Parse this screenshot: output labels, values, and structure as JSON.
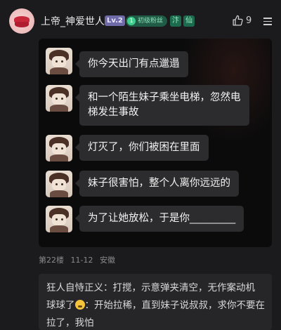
{
  "header": {
    "username": "上帝_神爱世人",
    "level": "Lv.2",
    "fan_badge_num": "1",
    "fan_badge_label": "初级粉丝",
    "title_badge_1": "汴",
    "title_badge_2": "仙",
    "like_count": "9",
    "icons": [
      "lips-avatar",
      "thumbs-up-icon",
      "more-menu-icon"
    ]
  },
  "screenshot": {
    "messages": [
      {
        "text": "你今天出门有点邋遢"
      },
      {
        "text": "和一个陌生妹子乘坐电梯，忽然电\n梯发生事故"
      },
      {
        "text": "灯灭了，你们被困在里面"
      },
      {
        "text": "妹子很害怕，整个人离你远远的"
      },
      {
        "text": "为了让她放松，于是你_________"
      }
    ]
  },
  "meta": {
    "floor": "第22楼",
    "date": "11-12",
    "location": "安徽"
  },
  "reply": {
    "author": "狂人自恃正义",
    "line1_after_author": "：打搅，示意弹夹清空，无作案动机",
    "line2_prefix": "球球了",
    "emoji_icon": "sweat-smile-icon",
    "line2_suffix": "：开始拉稀，直到妹子说叔叔，求你不要在",
    "line3": "拉了，我怕"
  }
}
